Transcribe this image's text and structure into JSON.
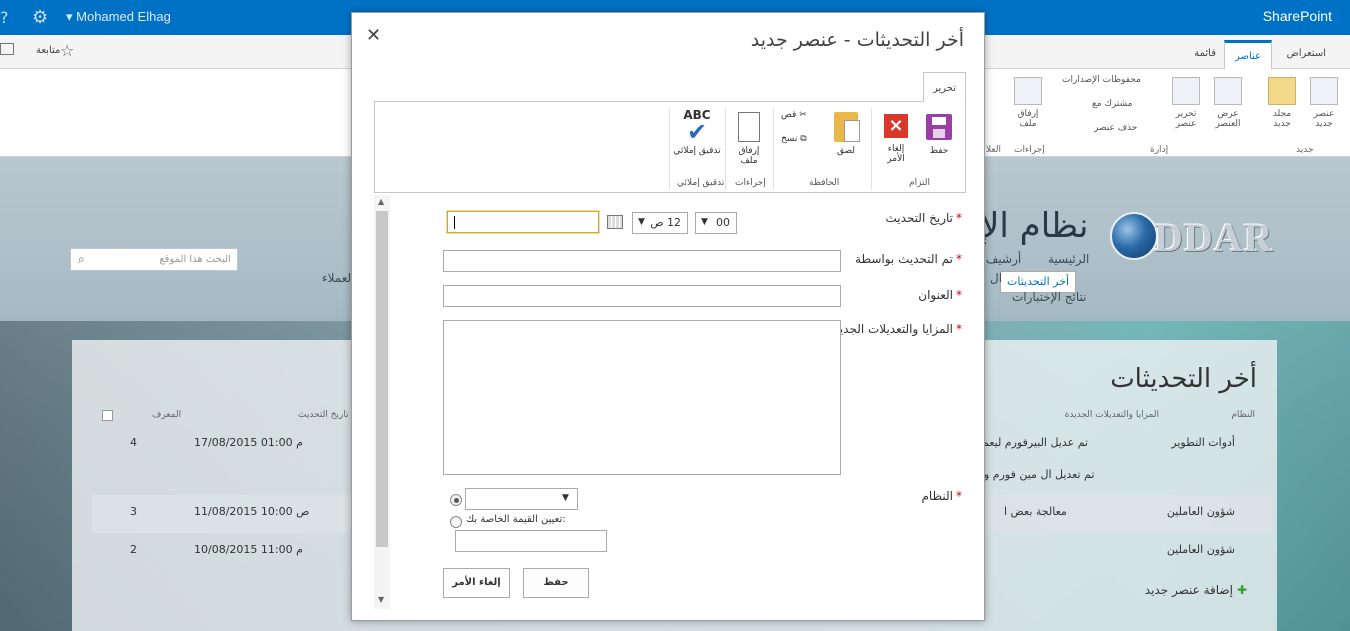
{
  "suitebar": {
    "brand": "SharePoint",
    "user": "Mohamed Elhag",
    "gear": "⚙",
    "help": "?"
  },
  "ribbon_tabs": {
    "browse": "استعراض",
    "items": "عناصر",
    "list": "قائمة",
    "follow": "متابعة"
  },
  "ribbon": {
    "new_item": "عنصر جديد",
    "new_folder": "مجلد جديد",
    "view_item": "عرض العنصر",
    "edit_item": "تحرير عنصر",
    "version_history": "محفوظات الإصدارات",
    "shared_with": "مشترك مع",
    "delete_item": "حذف عنصر",
    "attach_file": "إرفاق ملف",
    "group_new": "جديد",
    "group_manage": "إدارة",
    "group_actions": "إجراءات",
    "group_tags": "العلا"
  },
  "site": {
    "title": "نظام الإ",
    "logo_text": "DDAR",
    "nav": {
      "home": "الرئيسية",
      "archive": "أرشيف",
      "updates": "أخر التحديثات",
      "test_results": "نتائج الإختبارات",
      "partial": "ال",
      "clients": "لعملاء"
    },
    "search_placeholder": "البحث هذا الموقع"
  },
  "list": {
    "title": "أخر التحديثات",
    "headers": {
      "system": "النظام",
      "features": "المزايا والتعديلات الجديدة",
      "date": "تاريخ التحديث",
      "id": "المعرف"
    },
    "rows": [
      {
        "system": "أدوات التطوير",
        "features": "تم عديل البيرفورم ليعم",
        "features2": "تم تعديل ال مين فورم و",
        "date": "17/08/2015 01:00 م",
        "id": "4"
      },
      {
        "system": "شؤون العاملين",
        "features": "معالجة بعض ا",
        "date": "11/08/2015 10:00 ص",
        "id": "3"
      },
      {
        "system": "شؤون العاملين",
        "features": "",
        "date": "10/08/2015 11:00 م",
        "id": "2"
      }
    ],
    "add_new": "إضافة عنصر جديد"
  },
  "dialog": {
    "title": "أخر التحديثات - عنصر جديد",
    "close": "✕",
    "tab_edit": "تحرير",
    "ribbon": {
      "save": "حفظ",
      "cancel": "إلغاء الأمر",
      "paste": "لصق",
      "cut": "قص",
      "copy": "نسخ",
      "attach": "إرفاق ملف",
      "spelling": "تدقيق إملائي",
      "abc": "ABC",
      "grp_commit": "التزام",
      "grp_clipboard": "الحافظة",
      "grp_actions": "إجراءات",
      "grp_spelling": "تدقيق إملائي"
    },
    "form": {
      "date_label": "تاريخ التحديث",
      "hour_value": "12 ص",
      "minute_value": "00",
      "updated_by_label": "تم التحديث بواسطة",
      "title_label": "العنوان",
      "features_label": "المزايا والتعديلات الجديدة",
      "system_label": "النظام",
      "custom_value_label": ":تعيين القيمة الخاصة بك",
      "required_mark": "*"
    },
    "buttons": {
      "save": "حفظ",
      "cancel": "إلغاء الأمر"
    }
  }
}
